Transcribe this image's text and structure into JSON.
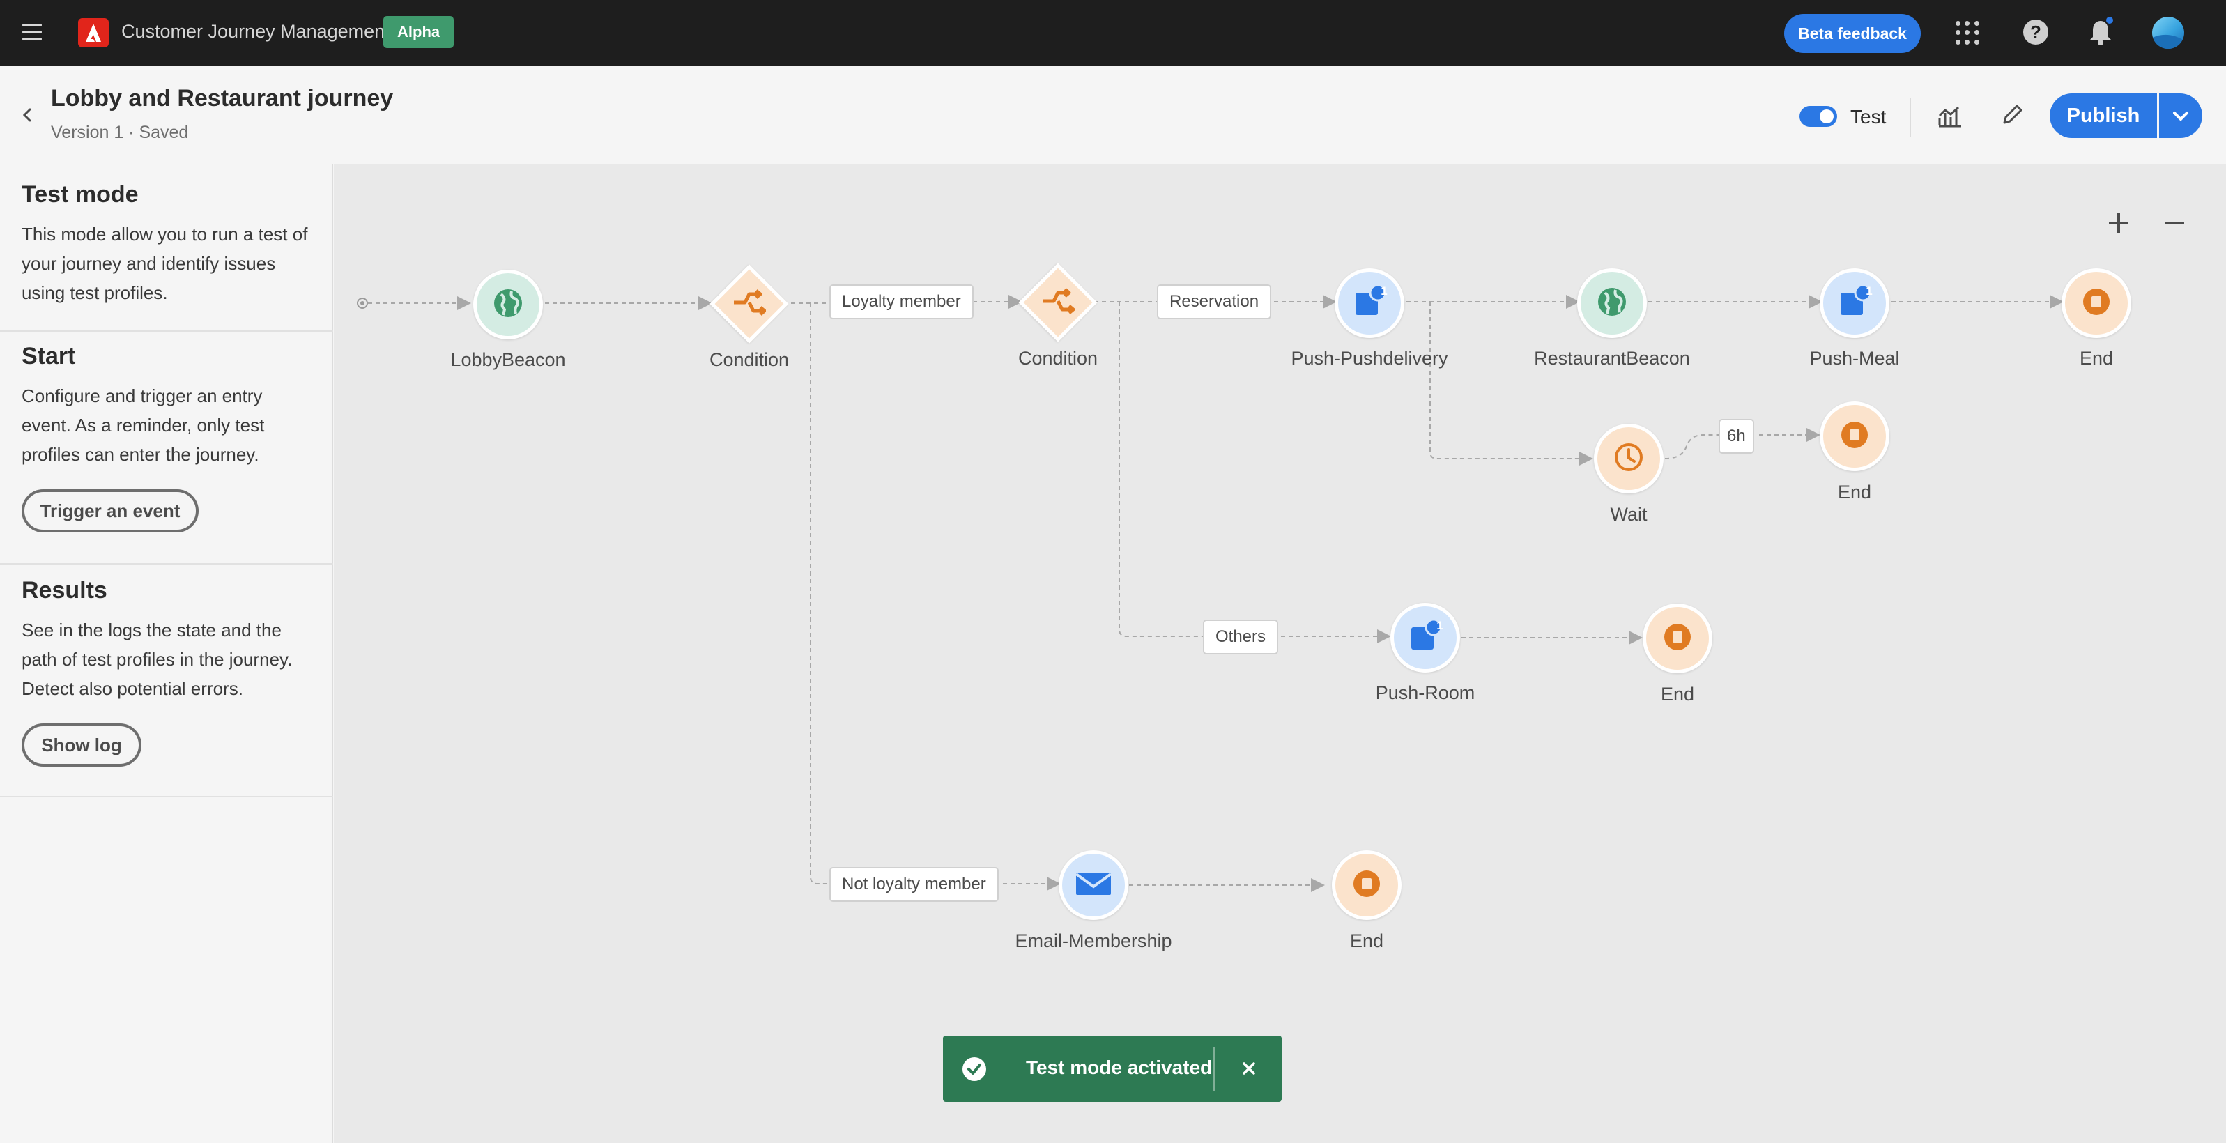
{
  "topbar": {
    "app_title": "Customer Journey Management",
    "alpha_badge": "Alpha",
    "beta_feedback": "Beta feedback",
    "accent": "#2b78e4"
  },
  "header": {
    "title": "Lobby and Restaurant journey",
    "status": "Version 1 · Saved",
    "toggle_label": "Test",
    "toggle_on": true,
    "publish_label": "Publish"
  },
  "panel": {
    "test_mode": {
      "title": "Test mode",
      "body": "This mode allow you to run a test of your journey and identify issues using test profiles."
    },
    "start": {
      "title": "Start",
      "body": "Configure and trigger an entry event. As a reminder, only test profiles can enter the journey.",
      "button": "Trigger an event"
    },
    "results": {
      "title": "Results",
      "body": "See in the logs the state and the path of test profiles in the journey. Detect also potential errors.",
      "button": "Show log"
    }
  },
  "canvas": {
    "nodes": {
      "lobby_beacon": "LobbyBeacon",
      "condition_1": "Condition",
      "condition_2": "Condition",
      "push_pushdelivery": "Push-Pushdelivery",
      "restaurant_beacon": "RestaurantBeacon",
      "push_meal": "Push-Meal",
      "end_1": "End",
      "wait": "Wait",
      "end_2": "End",
      "push_room": "Push-Room",
      "end_3": "End",
      "email_membership": "Email-Membership",
      "end_4": "End"
    },
    "badges": {
      "push_pushdelivery": "1",
      "push_meal": "1",
      "push_room": "1"
    },
    "edge_labels": {
      "loyalty_member": "Loyalty member",
      "reservation": "Reservation",
      "six_h": "6h",
      "others": "Others",
      "not_loyalty_member": "Not loyalty member"
    }
  },
  "toast": {
    "message": "Test mode activated",
    "color": "#2d7a53"
  }
}
